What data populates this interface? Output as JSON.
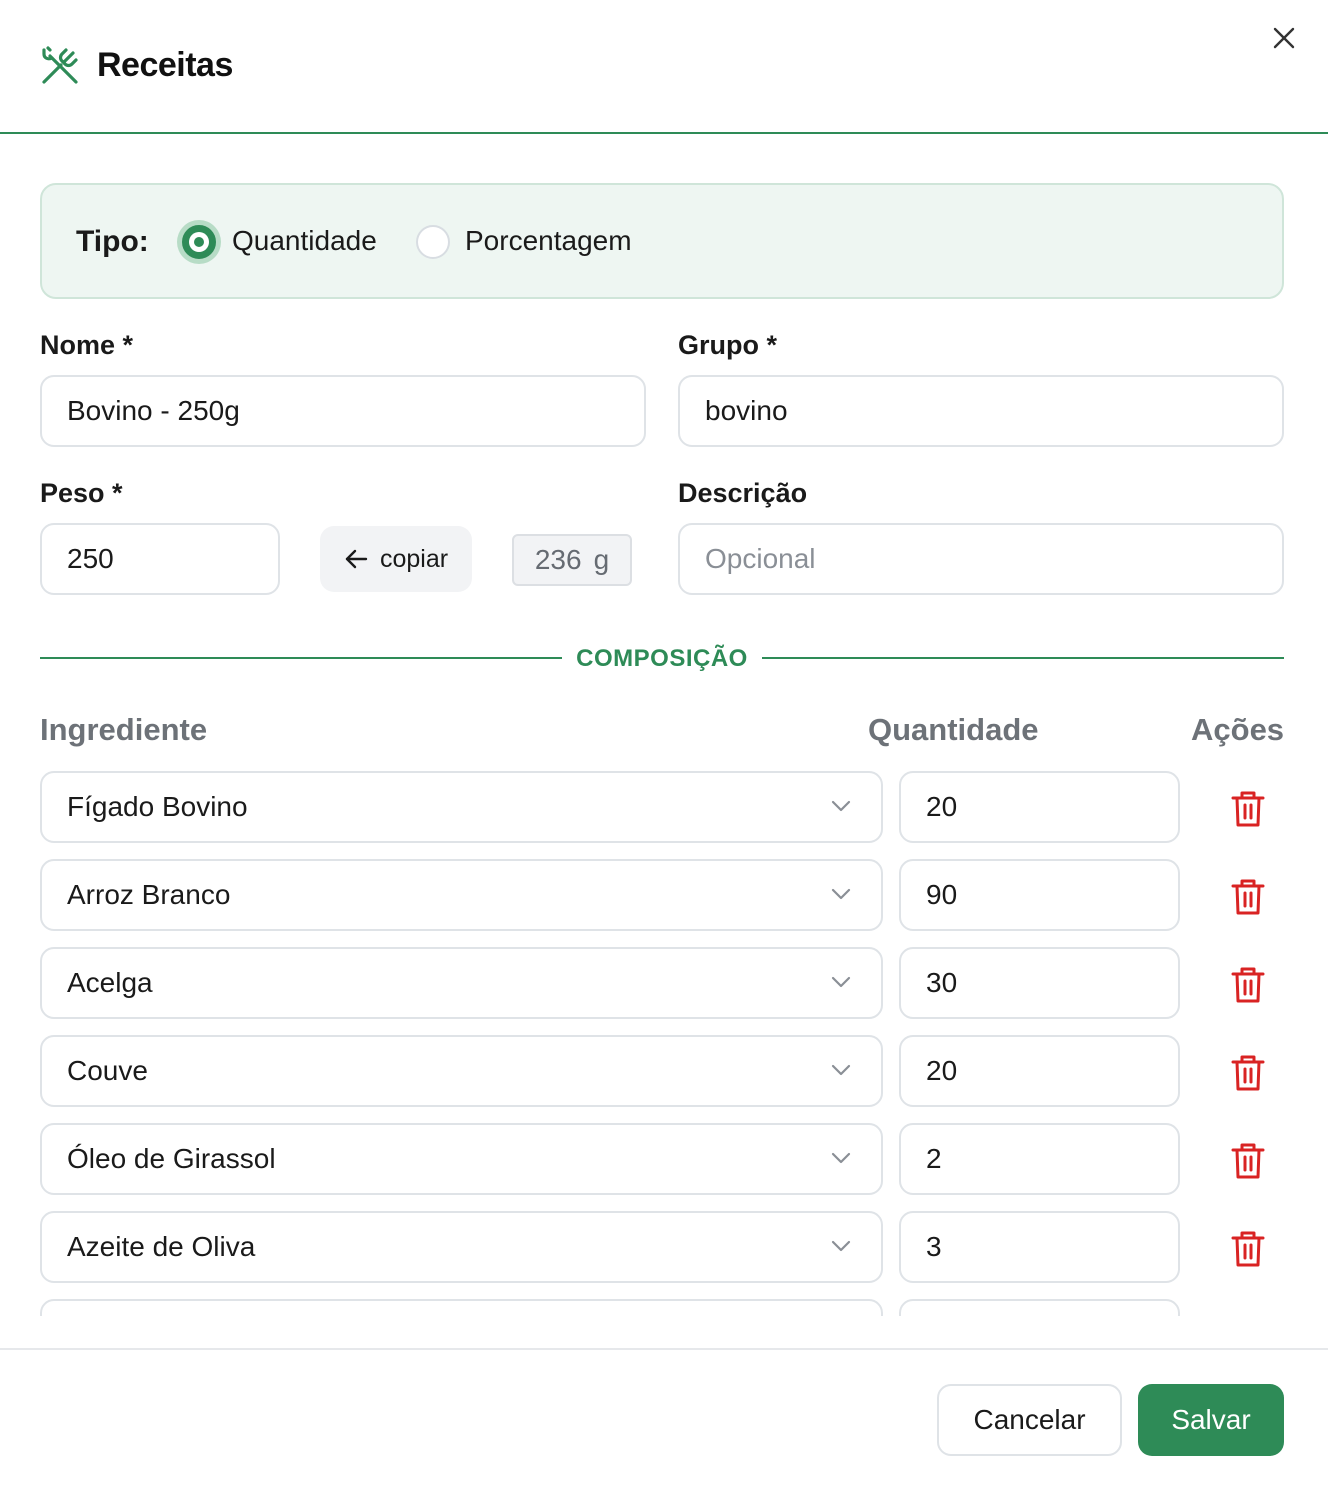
{
  "header": {
    "title": "Receitas",
    "icon": "utensils-crossed-icon",
    "close_icon": "close-icon"
  },
  "colors": {
    "accent": "#2e8b57",
    "danger": "#d92323",
    "muted_text": "#6d7278"
  },
  "tipo": {
    "label": "Tipo:",
    "options": [
      {
        "label": "Quantidade",
        "selected": true
      },
      {
        "label": "Porcentagem",
        "selected": false
      }
    ]
  },
  "form": {
    "nome": {
      "label": "Nome *",
      "value": "Bovino - 250g"
    },
    "grupo": {
      "label": "Grupo *",
      "value": "bovino"
    },
    "peso": {
      "label": "Peso *",
      "value": "250"
    },
    "copy_button": "copiar",
    "computed_weight": {
      "value": "236",
      "unit": "g"
    },
    "descricao": {
      "label": "Descrição",
      "placeholder": "Opcional"
    }
  },
  "composicao": {
    "title": "COMPOSIÇÃO",
    "columns": {
      "ingredient": "Ingrediente",
      "quantity": "Quantidade",
      "actions": "Ações"
    },
    "rows": [
      {
        "ingredient": "Fígado Bovino",
        "quantity": "20"
      },
      {
        "ingredient": "Arroz Branco",
        "quantity": "90"
      },
      {
        "ingredient": "Acelga",
        "quantity": "30"
      },
      {
        "ingredient": "Couve",
        "quantity": "20"
      },
      {
        "ingredient": "Óleo de Girassol",
        "quantity": "2"
      },
      {
        "ingredient": "Azeite de Oliva",
        "quantity": "3"
      },
      {
        "ingredient": "",
        "quantity": ""
      }
    ]
  },
  "footer": {
    "cancel": "Cancelar",
    "save": "Salvar"
  }
}
